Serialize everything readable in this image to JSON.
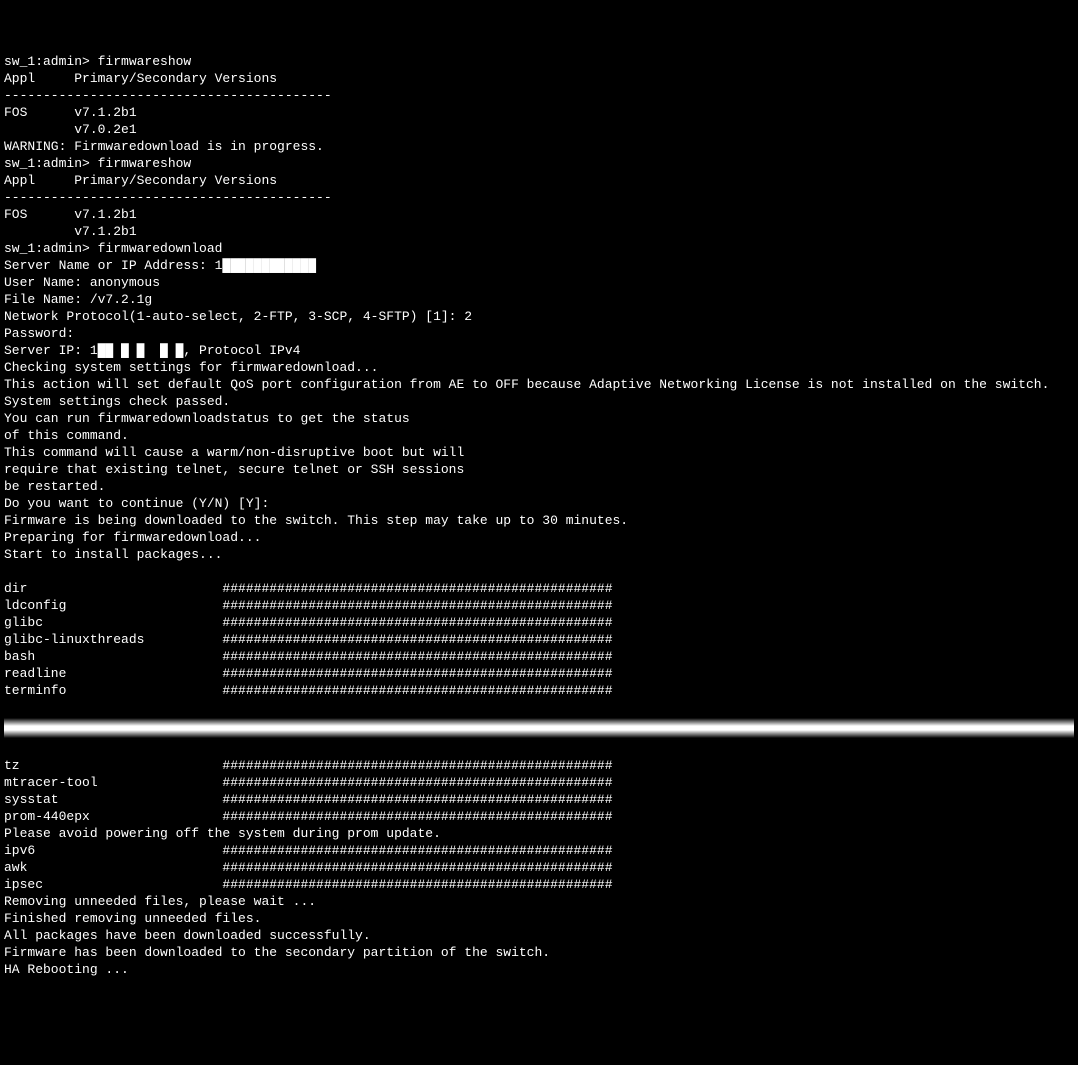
{
  "lines": [
    "sw_1:admin> firmwareshow",
    "Appl     Primary/Secondary Versions",
    "------------------------------------------",
    "FOS      v7.1.2b1",
    "         v7.0.2e1",
    "",
    "WARNING: Firmwaredownload is in progress.",
    "sw_1:admin> firmwareshow",
    "Appl     Primary/Secondary Versions",
    "------------------------------------------",
    "FOS      v7.1.2b1",
    "         v7.1.2b1",
    "sw_1:admin> firmwaredownload",
    "Server Name or IP Address: 1████████████",
    "User Name: anonymous",
    "File Name: /v7.2.1g",
    "Network Protocol(1-auto-select, 2-FTP, 3-SCP, 4-SFTP) [1]: 2",
    "Password:",
    "Server IP: 1██ █ █  █ █, Protocol IPv4",
    "Checking system settings for firmwaredownload...",
    "",
    "This action will set default QoS port configuration from AE to OFF because Adaptive Networking License is not installed on the switch.",
    "",
    "System settings check passed.",
    "",
    "You can run firmwaredownloadstatus to get the status",
    "of this command.",
    "",
    "This command will cause a warm/non-disruptive boot but will",
    "require that existing telnet, secure telnet or SSH sessions",
    "be restarted.",
    "",
    "",
    "",
    "Do you want to continue (Y/N) [Y]:",
    "Firmware is being downloaded to the switch. This step may take up to 30 minutes.",
    "Preparing for firmwaredownload...",
    "Start to install packages..."
  ],
  "packages1": [
    "dir                         ##################################################",
    "ldconfig                    ##################################################",
    "glibc                       ##################################################",
    "glibc-linuxthreads          ##################################################",
    "bash                        ##################################################",
    "readline                    ##################################################",
    "terminfo                    ##################################################"
  ],
  "packages2": [
    "tz                          ##################################################",
    "mtracer-tool                ##################################################",
    "sysstat                     ##################################################",
    "prom-440epx                 ##################################################",
    "Please avoid powering off the system during prom update.",
    "ipv6                        ##################################################",
    "awk                         ##################################################",
    "ipsec                       ##################################################",
    "Removing unneeded files, please wait ...",
    "Finished removing unneeded files.",
    "",
    "All packages have been downloaded successfully.",
    "Firmware has been downloaded to the secondary partition of the switch.",
    "HA Rebooting ..."
  ]
}
